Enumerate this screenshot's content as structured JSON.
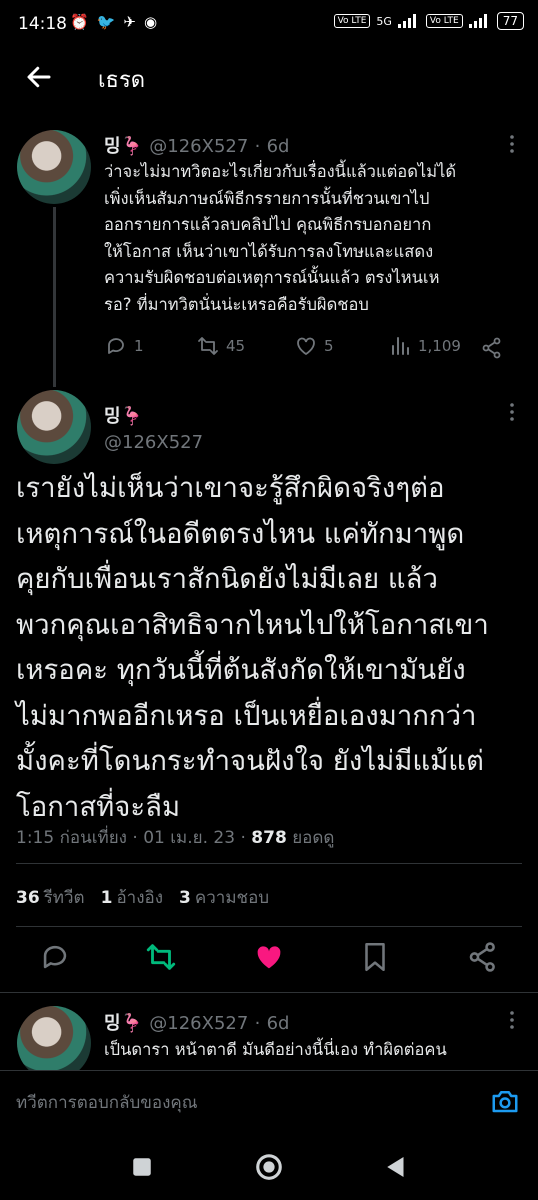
{
  "status_bar": {
    "time": "14:18",
    "network": "5G",
    "volte1": "Vo LTE",
    "volte2": "Vo LTE",
    "battery": "77"
  },
  "header": {
    "title": "เธรด"
  },
  "parent_tweet": {
    "name": "밍🦩",
    "handle": "@126X527",
    "dot": "·",
    "age": "6d",
    "text_lines": [
      "ว่าจะไม่มาทวิตอะไรเกี่ยวกับเรื่องนี้แล้วแต่อดไม่ได้",
      "เพิ่งเห็นสัมภาษณ์พิธีกรรายการนั้นที่ชวนเขาไป",
      "ออกรายการแล้วลบคลิปไป คุณพิธีกรบอกอยาก",
      "ให้โอกาส เห็นว่าเขาได้รับการลงโทษและแสดง",
      "ความรับผิดชอบต่อเหตุการณ์นั้นแล้ว ตรงไหนเห",
      "รอ? ที่มาทวิตนั่นน่ะเหรอคือรับผิดชอบ"
    ],
    "replies": "1",
    "retweets": "45",
    "likes": "5",
    "views": "1,109"
  },
  "main_tweet": {
    "name": "밍🦩",
    "handle": "@126X527",
    "text_lines": [
      "เรายังไม่เห็นว่าเขาจะรู้สึกผิดจริงๆต่อ",
      "เหตุการณ์ในอดีตตรงไหน แค่ทักมาพูด",
      "คุยกับเพื่อนเราสักนิดยังไม่มีเลย แล้ว",
      "พวกคุณเอาสิทธิจากไหนไปให้โอกาสเขา",
      "เหรอคะ ทุกวันนี้ที่ต้นสังกัดให้เขามันยัง",
      "ไม่มากพออีกเหรอ เป็นเหยื่อเองมากกว่า",
      "มั้งคะที่โดนกระทำจนฝังใจ ยังไม่มีแม้แต่",
      "โอกาสที่จะลืม"
    ],
    "time": "1:15 ก่อนเที่ยง",
    "dot": "·",
    "date": "01 เม.ย. 23",
    "views_count": "878",
    "views_label": "ยอดดู",
    "retweets_count": "36",
    "retweets_label": "รีทวีต",
    "quotes_count": "1",
    "quotes_label": "อ้างอิง",
    "likes_count": "3",
    "likes_label": "ความชอบ"
  },
  "reply_tweet": {
    "name": "밍🦩",
    "handle": "@126X527",
    "dot": "·",
    "age": "6d",
    "text": "เป็นดารา หน้าตาดี มันดีอย่างนี้นี่เอง ทำผิดต่อคน"
  },
  "reply_bar": {
    "placeholder": "ทวีตการตอบกลับของคุณ"
  },
  "colors": {
    "background": "#000000",
    "retweet_active": "#00ba7c",
    "like_active": "#f91880",
    "link": "#1d9bf0",
    "muted": "#71767b"
  }
}
